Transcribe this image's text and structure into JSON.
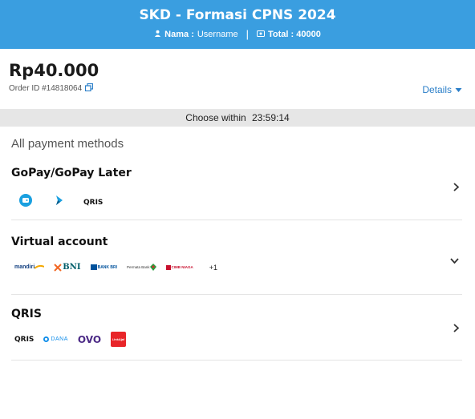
{
  "header": {
    "title": "SKD - Formasi CPNS 2024",
    "name_label": "Nama :",
    "name_value": "Username",
    "total_label": "Total : 40000"
  },
  "summary": {
    "amount": "Rp40.000",
    "order_id": "Order ID #14818064",
    "details_label": "Details"
  },
  "timer": {
    "label": "Choose within",
    "value": "23:59:14"
  },
  "payment": {
    "section_title": "All payment methods",
    "methods": [
      {
        "title": "GoPay/GoPay Later",
        "logos": [
          "gopay-icon",
          "gopay-later-icon",
          "QRIS"
        ]
      },
      {
        "title": "Virtual account",
        "logos": [
          "mandiri",
          "BNI",
          "BANK BRI",
          "Permata Bank",
          "CIMB NIAGA"
        ],
        "more": "+1"
      },
      {
        "title": "QRIS",
        "logos": [
          "QRIS",
          "DANA",
          "OVO",
          "LinkAja!"
        ]
      }
    ]
  },
  "colors": {
    "header_bg": "#3a9ee0",
    "link": "#2a7ec8",
    "timer_bg": "#e6e6e6"
  }
}
